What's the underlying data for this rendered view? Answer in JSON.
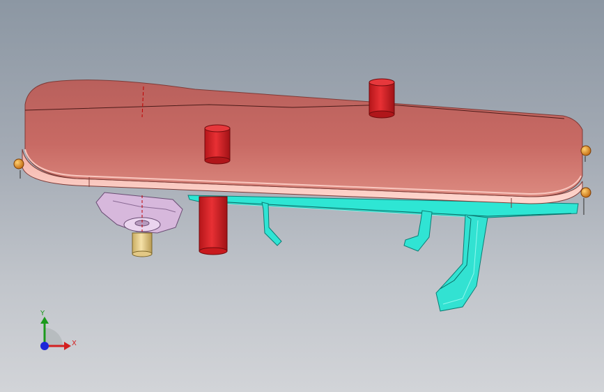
{
  "window": {
    "title": ""
  },
  "viewport": {
    "background_top": "#8c97a3",
    "background_bottom": "#d2d4d8"
  },
  "model_parts": [
    {
      "name": "top-cover",
      "color": "#c0605c"
    },
    {
      "name": "cylinder-pin",
      "color": "#d8262a"
    },
    {
      "name": "bottom-plate",
      "color": "#24e0d0"
    },
    {
      "name": "knob-cap",
      "color": "#d8b8dc"
    },
    {
      "name": "knob-shaft",
      "color": "#efd79a"
    },
    {
      "name": "edge-bolt",
      "color": "#e08a1c"
    }
  ],
  "triad": {
    "x_label": "X",
    "y_label": "Y",
    "x_color": "#d32020",
    "y_color": "#1c9a1c",
    "z_color": "#1e28d8"
  }
}
